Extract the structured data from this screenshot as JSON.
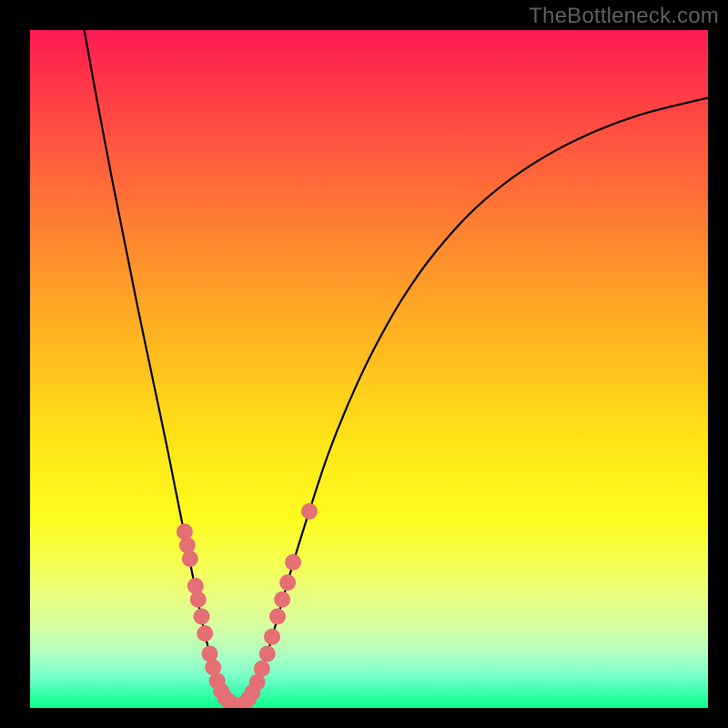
{
  "watermark": "TheBottleneck.com",
  "chart_data": {
    "type": "line",
    "title": "",
    "xlabel": "",
    "ylabel": "",
    "xlim": [
      0,
      100
    ],
    "ylim": [
      0,
      100
    ],
    "grid": false,
    "series": [
      {
        "name": "curve",
        "style": "smooth-line",
        "color": "#000000",
        "points": [
          {
            "x": 8.0,
            "y": 100.0
          },
          {
            "x": 10.0,
            "y": 89.0
          },
          {
            "x": 12.0,
            "y": 78.5
          },
          {
            "x": 14.0,
            "y": 68.5
          },
          {
            "x": 16.0,
            "y": 58.5
          },
          {
            "x": 18.0,
            "y": 49.0
          },
          {
            "x": 20.0,
            "y": 39.5
          },
          {
            "x": 21.5,
            "y": 32.0
          },
          {
            "x": 23.0,
            "y": 24.5
          },
          {
            "x": 24.5,
            "y": 17.0
          },
          {
            "x": 26.0,
            "y": 10.0
          },
          {
            "x": 27.5,
            "y": 4.5
          },
          {
            "x": 29.0,
            "y": 1.5
          },
          {
            "x": 30.0,
            "y": 0.5
          },
          {
            "x": 31.0,
            "y": 0.3
          },
          {
            "x": 32.0,
            "y": 1.0
          },
          {
            "x": 33.5,
            "y": 3.5
          },
          {
            "x": 35.0,
            "y": 8.0
          },
          {
            "x": 37.0,
            "y": 15.0
          },
          {
            "x": 39.0,
            "y": 22.0
          },
          {
            "x": 41.5,
            "y": 30.0
          },
          {
            "x": 44.0,
            "y": 37.5
          },
          {
            "x": 47.0,
            "y": 45.0
          },
          {
            "x": 50.5,
            "y": 52.5
          },
          {
            "x": 55.0,
            "y": 60.5
          },
          {
            "x": 60.0,
            "y": 67.5
          },
          {
            "x": 66.0,
            "y": 74.0
          },
          {
            "x": 73.0,
            "y": 79.5
          },
          {
            "x": 81.0,
            "y": 84.0
          },
          {
            "x": 90.0,
            "y": 87.5
          },
          {
            "x": 100.0,
            "y": 90.0
          }
        ]
      },
      {
        "name": "markers",
        "style": "scatter",
        "color": "#e46f74",
        "radius": 1.2,
        "points": [
          {
            "x": 22.8,
            "y": 26.0
          },
          {
            "x": 23.2,
            "y": 24.0
          },
          {
            "x": 23.6,
            "y": 22.0
          },
          {
            "x": 24.4,
            "y": 18.0
          },
          {
            "x": 24.8,
            "y": 16.0
          },
          {
            "x": 25.3,
            "y": 13.5
          },
          {
            "x": 25.8,
            "y": 11.0
          },
          {
            "x": 26.5,
            "y": 8.0
          },
          {
            "x": 27.0,
            "y": 6.0
          },
          {
            "x": 27.6,
            "y": 4.0
          },
          {
            "x": 28.2,
            "y": 2.5
          },
          {
            "x": 28.8,
            "y": 1.5
          },
          {
            "x": 29.5,
            "y": 0.8
          },
          {
            "x": 30.2,
            "y": 0.4
          },
          {
            "x": 30.8,
            "y": 0.3
          },
          {
            "x": 31.5,
            "y": 0.6
          },
          {
            "x": 32.2,
            "y": 1.3
          },
          {
            "x": 32.8,
            "y": 2.3
          },
          {
            "x": 33.5,
            "y": 3.8
          },
          {
            "x": 34.2,
            "y": 5.8
          },
          {
            "x": 35.0,
            "y": 8.0
          },
          {
            "x": 35.7,
            "y": 10.5
          },
          {
            "x": 36.5,
            "y": 13.5
          },
          {
            "x": 37.2,
            "y": 16.0
          },
          {
            "x": 38.0,
            "y": 18.5
          },
          {
            "x": 38.8,
            "y": 21.5
          },
          {
            "x": 41.2,
            "y": 29.0
          }
        ]
      }
    ]
  }
}
